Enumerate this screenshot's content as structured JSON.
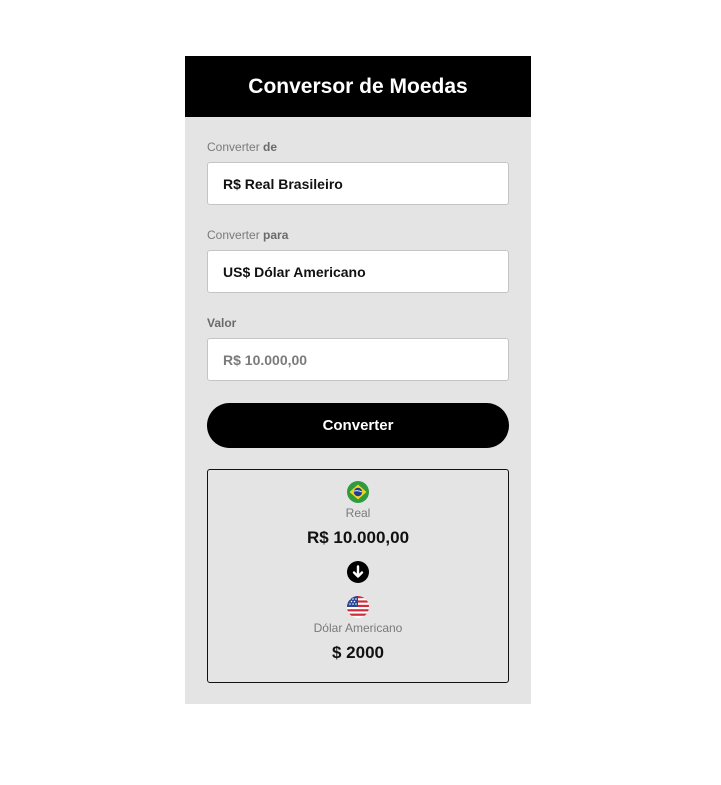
{
  "header": {
    "title": "Conversor de Moedas"
  },
  "form": {
    "from": {
      "label_prefix": "Converter",
      "label_strong": "de",
      "value": "R$ Real Brasileiro"
    },
    "to": {
      "label_prefix": "Converter",
      "label_strong": "para",
      "value": "US$ Dólar Americano"
    },
    "amount": {
      "label": "Valor",
      "value": "R$ 10.000,00"
    },
    "button_label": "Converter"
  },
  "result": {
    "source": {
      "flag_icon": "brazil-flag-icon",
      "name": "Real",
      "amount": "R$ 10.000,00"
    },
    "arrow_icon": "arrow-down-icon",
    "target": {
      "flag_icon": "usa-flag-icon",
      "name": "Dólar Americano",
      "amount": "$ 2000"
    }
  },
  "colors": {
    "header_bg": "#000000",
    "panel_bg": "#e4e4e4",
    "button_bg": "#000000",
    "label_gray": "#7a7a7a"
  }
}
